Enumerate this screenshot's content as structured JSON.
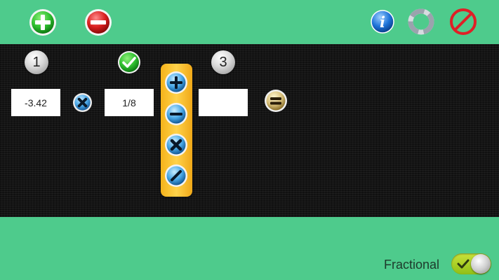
{
  "toolbar": {
    "add_icon": "plus-icon",
    "remove_icon": "minus-icon",
    "info_icon": "info-icon",
    "reset_icon": "refresh-icon",
    "stop_icon": "no-entry-icon"
  },
  "steps": {
    "first": "1",
    "second_completed": true,
    "third": "3"
  },
  "calculation": {
    "operand_a": "-3.42",
    "operator_icon": "multiply-icon",
    "operand_b": "1/8",
    "result": "",
    "equals_icon": "equals-icon"
  },
  "operators": [
    "plus-icon",
    "minus-icon",
    "multiply-icon",
    "divide-icon"
  ],
  "footer": {
    "toggle_label": "Fractional",
    "toggle_on": true
  },
  "colors": {
    "background": "#4ecb8c",
    "board": "#141414",
    "accent_yellow": "#f5b31a",
    "add_green": "#2fbf2f",
    "remove_red": "#d81e1e",
    "info_blue": "#1e73d8"
  }
}
